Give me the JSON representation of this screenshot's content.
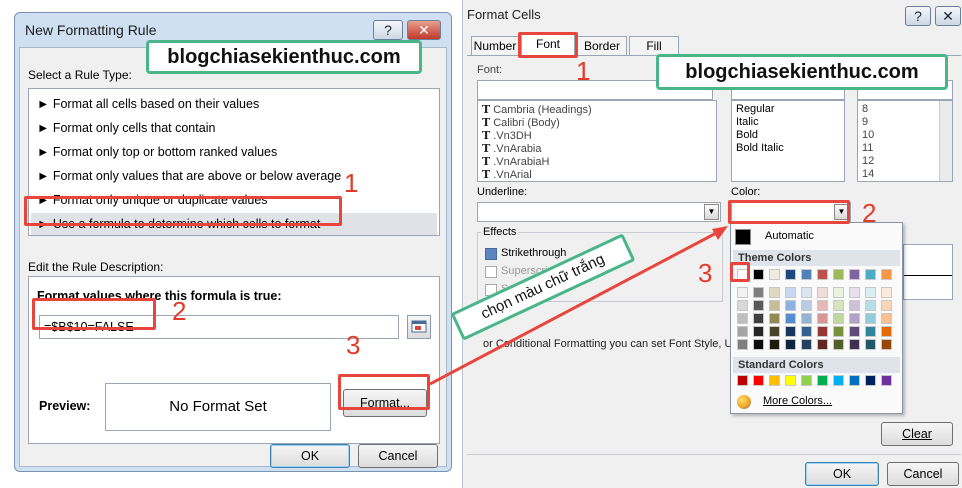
{
  "left_dialog": {
    "title": "New Formatting Rule",
    "help_button": "?",
    "close_button": "✕",
    "watermark": "blogchiasekienthuc.com",
    "select_rule_type_label": "Select a Rule Type:",
    "rule_types": [
      "► Format all cells based on their values",
      "► Format only cells that contain",
      "► Format only top or bottom ranked values",
      "► Format only values that are above or below average",
      "► Format only unique or duplicate values",
      "► Use a formula to determine which cells to format"
    ],
    "edit_description_label": "Edit the Rule Description:",
    "formula_label": "Format values where this formula is true:",
    "formula_value": "=$B$10=FALSE",
    "preview_label": "Preview:",
    "preview_text": "No Format Set",
    "format_button": "Format...",
    "ok_button": "OK",
    "cancel_button": "Cancel",
    "step_labels": [
      "1",
      "2",
      "3"
    ]
  },
  "right_dialog": {
    "title": "Format Cells",
    "help_button": "?",
    "close_button": "✕",
    "tabs": [
      "Number",
      "Font",
      "Border",
      "Fill"
    ],
    "active_tab": "Font",
    "watermark": "blogchiasekienthuc.com",
    "font_label": "Font:",
    "fonts": [
      "Cambria (Headings)",
      "Calibri (Body)",
      ".Vn3DH",
      ".VnArabia",
      ".VnArabiaH",
      ".VnArial"
    ],
    "font_styles": [
      "Regular",
      "Italic",
      "Bold",
      "Bold Italic"
    ],
    "sizes": [
      "8",
      "9",
      "10",
      "11",
      "12",
      "14"
    ],
    "underline_label": "Underline:",
    "color_label": "Color:",
    "effects_label": "Effects",
    "effects": [
      "Strikethrough",
      "Superscript",
      "S"
    ],
    "info_text": "or Conditional Formatting you can set Font Style, Un",
    "annotation_text": "chọn màu chữ trắng",
    "clear_button": "Clear",
    "ok_button": "OK",
    "cancel_button": "Cancel",
    "step_labels": [
      "1",
      "2",
      "3"
    ],
    "palette": {
      "automatic": "Automatic",
      "theme_colors_label": "Theme Colors",
      "standard_colors_label": "Standard Colors",
      "more_colors": "More Colors...",
      "theme_top": [
        "#FFFFFF",
        "#000000",
        "#EEECE1",
        "#1F497D",
        "#4F81BD",
        "#C0504D",
        "#9BBB59",
        "#8064A2",
        "#4BACC6",
        "#F79646"
      ],
      "theme_shades": [
        [
          "#F2F2F2",
          "#7F7F7F",
          "#DDD9C3",
          "#C6D9F0",
          "#DBE5F1",
          "#F2DCDB",
          "#EBF1DD",
          "#E5E0EC",
          "#DBEEF3",
          "#FDEADA"
        ],
        [
          "#D8D8D8",
          "#595959",
          "#C4BD97",
          "#8DB3E2",
          "#B8CCE4",
          "#E5B9B7",
          "#D7E3BC",
          "#CCC1D9",
          "#B7DDE8",
          "#FBD5B5"
        ],
        [
          "#BFBFBF",
          "#3F3F3F",
          "#938953",
          "#548DD4",
          "#95B3D7",
          "#D99694",
          "#C3D69B",
          "#B2A2C7",
          "#92CDDC",
          "#FAC08F"
        ],
        [
          "#A5A5A5",
          "#262626",
          "#494429",
          "#17365D",
          "#366092",
          "#953734",
          "#76923C",
          "#5F497A",
          "#31859B",
          "#E36C09"
        ],
        [
          "#7F7F7F",
          "#0C0C0C",
          "#1D1B10",
          "#0F243E",
          "#244061",
          "#632423",
          "#4F6128",
          "#3F3151",
          "#205867",
          "#974806"
        ]
      ],
      "standard": [
        "#C00000",
        "#FF0000",
        "#FFC000",
        "#FFFF00",
        "#92D050",
        "#00B050",
        "#00B0F0",
        "#0070C0",
        "#002060",
        "#7030A0"
      ]
    }
  }
}
